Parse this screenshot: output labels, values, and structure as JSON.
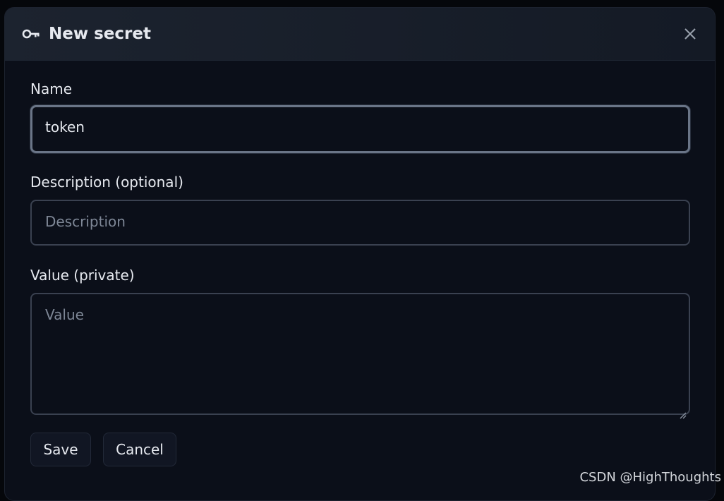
{
  "dialog": {
    "title": "New secret",
    "icon": "key-icon",
    "close_icon": "close-icon"
  },
  "fields": {
    "name": {
      "label": "Name",
      "value": "token"
    },
    "description": {
      "label": "Description (optional)",
      "placeholder": "Description"
    },
    "value": {
      "label": "Value (private)",
      "placeholder": "Value"
    }
  },
  "actions": {
    "save_label": "Save",
    "cancel_label": "Cancel"
  },
  "watermark": "CSDN @HighThoughts",
  "colors": {
    "background": "#0b0f19",
    "header": "#1c232f",
    "text": "#e6e9ef",
    "placeholder": "#7e8796",
    "border": "#3a4150",
    "focus_border": "#6a7587"
  }
}
